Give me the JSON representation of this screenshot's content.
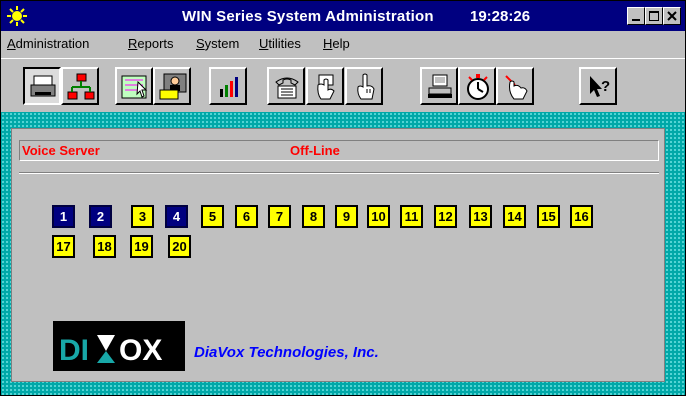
{
  "window": {
    "title": "WIN Series System Administration",
    "clock": "19:28:26"
  },
  "menu": [
    {
      "first": "A",
      "rest": "dministration"
    },
    {
      "first": "R",
      "rest": "eports"
    },
    {
      "first": "S",
      "rest": "ystem"
    },
    {
      "first": "U",
      "rest": "tilities"
    },
    {
      "first": "H",
      "rest": "elp"
    }
  ],
  "toolbar": {
    "buttons": [
      "printer-icon",
      "network-tree-icon",
      "cursor-map-icon",
      "user-card-icon",
      "bar-chart-icon",
      "telephone-icon",
      "hand-card-icon",
      "hand-pointing-icon",
      "computer-icon",
      "stopwatch-icon",
      "hand-cursor-icon",
      "context-help-icon"
    ],
    "pressed": [
      "printer-icon"
    ]
  },
  "status": {
    "label": "Voice Server",
    "value": "Off-Line",
    "color": "#ff0000"
  },
  "ports": [
    {
      "label": "1",
      "active": true
    },
    {
      "label": "2",
      "active": true
    },
    {
      "label": "3",
      "active": false
    },
    {
      "label": "4",
      "active": true
    },
    {
      "label": "5",
      "active": false
    },
    {
      "label": "6",
      "active": false
    },
    {
      "label": "7",
      "active": false
    },
    {
      "label": "8",
      "active": false
    },
    {
      "label": "9",
      "active": false
    },
    {
      "label": "10",
      "active": false
    },
    {
      "label": "11",
      "active": false
    },
    {
      "label": "12",
      "active": false
    },
    {
      "label": "13",
      "active": false
    },
    {
      "label": "14",
      "active": false
    },
    {
      "label": "15",
      "active": false
    },
    {
      "label": "16",
      "active": false
    },
    {
      "label": "17",
      "active": false
    },
    {
      "label": "18",
      "active": false
    },
    {
      "label": "19",
      "active": false
    },
    {
      "label": "20",
      "active": false
    }
  ],
  "logo": {
    "text": "DIAVOX"
  },
  "company": "DiaVox Technologies, Inc.",
  "colors": {
    "titlebar": "#000080",
    "desktop": "#00a8a8",
    "port_idle": "#ffff00",
    "port_active": "#000080",
    "company": "#0000ff"
  }
}
